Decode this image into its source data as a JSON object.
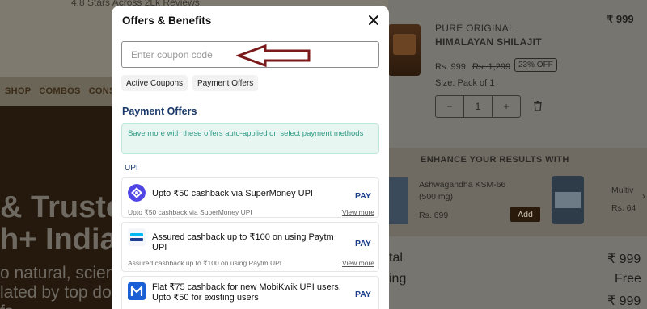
{
  "background": {
    "top_strip_text": "4.8 Stars Across 2Lk Reviews",
    "nav": [
      "SHOP",
      "COMBOS",
      "CONS"
    ],
    "hero": {
      "line1": "& Truste",
      "line2": "h+ India",
      "line3": "o natural, science-b",
      "line4": "lated by top doctor",
      "line5": "fs."
    },
    "product": {
      "brand": "PURE ORIGINAL",
      "name": "HIMALAYAN SHILAJIT",
      "price_top": "₹ 999",
      "price": "Rs. 999",
      "mrp": "Rs. 1,299",
      "discount": "23% OFF",
      "size": "Size: Pack of 1",
      "qty_minus": "−",
      "qty_value": "1",
      "qty_plus": "+"
    },
    "enhance": {
      "title": "ENHANCE YOUR RESULTS WITH",
      "item1_name": "Ashwagandha KSM-66 (500 mg)",
      "item1_price": "Rs. 699",
      "add": "Add",
      "item2_name": "Multiv",
      "item2_price": "Rs. 64"
    },
    "summary": [
      {
        "label": "tal",
        "value": "₹ 999"
      },
      {
        "label": "ing",
        "value": "Free"
      },
      {
        "label": "",
        "value": "₹ 999"
      }
    ]
  },
  "modal": {
    "title": "Offers & Benefits",
    "coupon_placeholder": "Enter coupon code",
    "tabs": [
      "Active Coupons",
      "Payment Offers"
    ],
    "section_title": "Payment Offers",
    "info_text": "Save more with these offers auto-applied on select payment methods",
    "upi_label": "UPI",
    "offers": [
      {
        "title": "Upto ₹50 cashback via SuperMoney UPI",
        "subtitle": "Upto ₹50 cashback via SuperMoney UPI",
        "action": "PAY",
        "link": "View more",
        "logo": "supermoney-logo-icon"
      },
      {
        "title": "Assured cashback up to ₹100 on using Paytm UPI",
        "subtitle": "Assured cashback up to ₹100 on using Paytm UPI",
        "action": "PAY",
        "link": "View more",
        "logo": "paytm-logo-icon"
      },
      {
        "title": "Flat ₹75 cashback for new MobiKwik UPI users. Upto ₹50 for existing users",
        "subtitle": "",
        "action": "PAY",
        "link": "",
        "logo": "mobikwik-logo-icon"
      }
    ]
  },
  "colors": {
    "accent_navy": "#1a3e8c",
    "info_green": "#2e9a83",
    "arrow_maroon": "#7a1a1a"
  }
}
